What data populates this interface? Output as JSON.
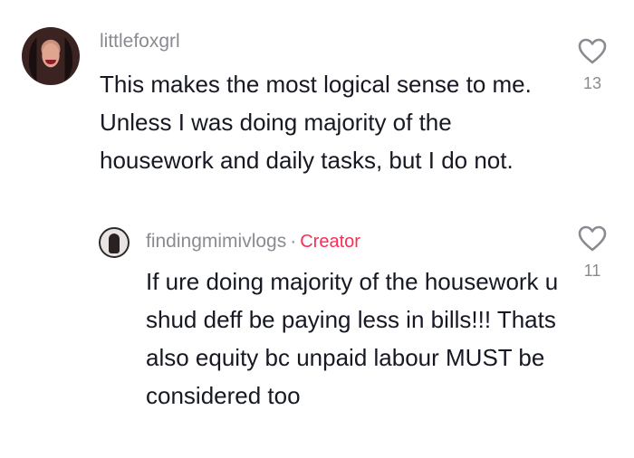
{
  "comment": {
    "username": "littlefoxgrl",
    "text": "This makes the most logical sense to me. Unless I was doing majority of the housework and daily tasks, but I do not.",
    "likes": "13",
    "like_icon": "heart-outline-icon"
  },
  "reply": {
    "username": "findingmimivlogs",
    "separator": "·",
    "badge": "Creator",
    "badge_color": "#fe2c55",
    "text": "If ure doing majority of the housework u shud deff be paying less in bills!!! Thats also equity bc unpaid labour MUST be considered too",
    "likes": "11",
    "like_icon": "heart-outline-icon"
  }
}
